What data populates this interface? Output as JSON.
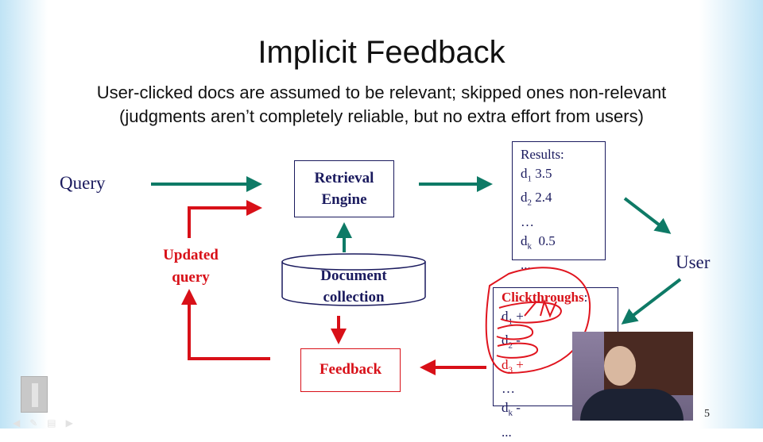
{
  "slide": {
    "title": "Implicit Feedback",
    "subtitle_line1": "User-clicked docs are assumed to be relevant; skipped ones non-relevant",
    "subtitle_line2": "(judgments aren’t completely reliable, but no extra effort from users)",
    "page_number": "5"
  },
  "diagram": {
    "query": "Query",
    "engine_line1": "Retrieval",
    "engine_line2": "Engine",
    "collection_line1": "Document",
    "collection_line2": "collection",
    "feedback": "Feedback",
    "updated_line1": "Updated",
    "updated_line2": "query",
    "user": "User",
    "results": {
      "header": "Results:",
      "rows": [
        {
          "doc": "d",
          "sub": "1",
          "val": "3.5"
        },
        {
          "doc": "d",
          "sub": "2",
          "val": "2.4"
        },
        {
          "doc": "…",
          "sub": "",
          "val": ""
        },
        {
          "doc": "d",
          "sub": "k",
          "val": "0.5"
        },
        {
          "doc": "...",
          "sub": "",
          "val": ""
        }
      ]
    },
    "clickthroughs": {
      "header": "Clickthroughs",
      "colon": ":",
      "rows": [
        {
          "doc": "d",
          "sub": "1",
          "val": "+"
        },
        {
          "doc": "d",
          "sub": "2",
          "val": "-"
        },
        {
          "doc": "d",
          "sub": "3",
          "val": "+"
        },
        {
          "doc": "…",
          "sub": "",
          "val": ""
        },
        {
          "doc": "d",
          "sub": "k",
          "val": "-"
        },
        {
          "doc": "...",
          "sub": "",
          "val": ""
        }
      ]
    }
  },
  "colors": {
    "teal": "#0e7a66",
    "red": "#d81018",
    "navy": "#1a1a5e"
  }
}
